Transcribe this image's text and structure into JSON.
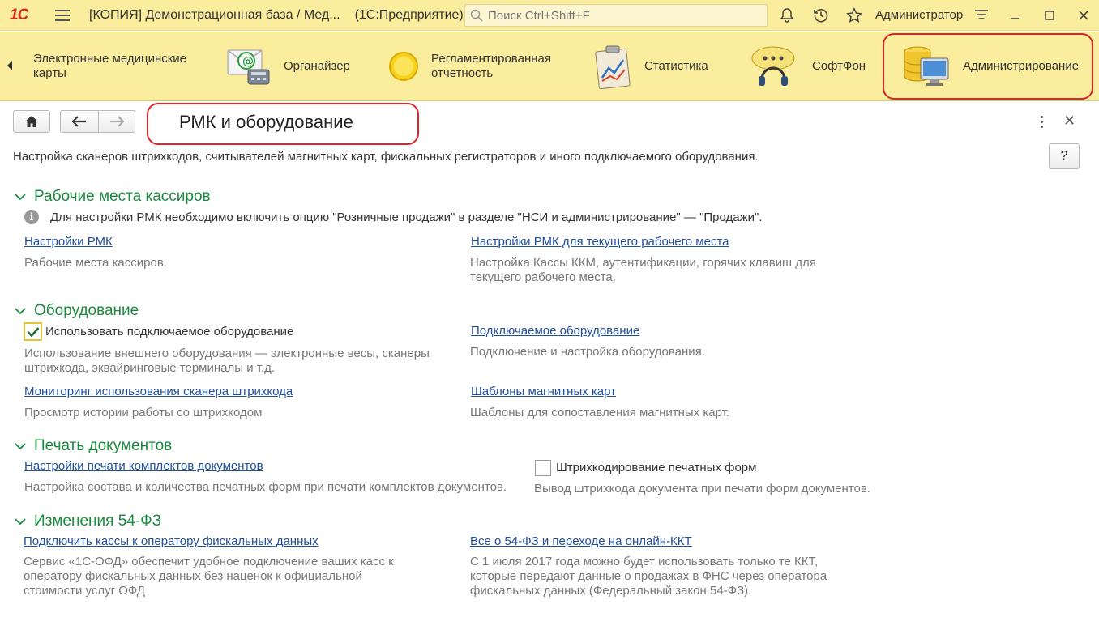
{
  "titlebar": {
    "logo": "1С",
    "title": "[КОПИЯ] Демонстрационная база / Мед...",
    "platform": "(1С:Предприятие)",
    "search_placeholder": "Поиск Ctrl+Shift+F",
    "user": "Администратор"
  },
  "sections": [
    {
      "label": "Электронные медицинские карты",
      "icon": "none"
    },
    {
      "label": "Органайзер",
      "icon": "organizer-icon"
    },
    {
      "label": "Регламентированная отчетность",
      "icon": "reporting-icon"
    },
    {
      "label": "Статистика",
      "icon": "statistics-icon"
    },
    {
      "label": "СофтФон",
      "icon": "softphone-icon"
    },
    {
      "label": "Администрирование",
      "icon": "administration-icon",
      "active": true
    }
  ],
  "form": {
    "title": "РМК и оборудование",
    "description": "Настройка сканеров штрихкодов, считывателей магнитных карт, фискальных регистраторов и иного подключаемого оборудования.",
    "help_label": "?"
  },
  "groups": {
    "cashiers": {
      "title": "Рабочие места кассиров",
      "info": "Для настройки РМК необходимо включить опцию \"Розничные продажи\" в разделе \"НСИ и администрирование\" — \"Продажи\".",
      "link1": "Настройки РМК",
      "note1": "Рабочие места кассиров.",
      "link2": "Настройки РМК для текущего рабочего места",
      "note2_line1": "Настройка Кассы ККМ, аутентификации, горячих клавиш для",
      "note2_line2": "текущего рабочего места."
    },
    "equipment": {
      "title": "Оборудование",
      "checkbox_label": "Использовать подключаемое оборудование",
      "checkbox_checked": true,
      "note1_line1": "Использование внешнего оборудования — электронные весы, сканеры",
      "note1_line2": "штрихкода, эквайринговые терминалы и т.д.",
      "link2": "Подключаемое оборудование",
      "note2": "Подключение и настройка оборудования.",
      "link3": "Мониторинг использования сканера штрихкода",
      "note3": "Просмотр истории работы со штрихкодом",
      "link4": "Шаблоны магнитных карт",
      "note4": "Шаблоны для сопоставления магнитных карт."
    },
    "printing": {
      "title": "Печать документов",
      "link1": "Настройки печати комплектов документов",
      "note1": "Настройка состава и количества печатных форм при печати комплектов документов.",
      "checkbox_label": "Штрихкодирование печатных форм",
      "checkbox_checked": false,
      "note2": "Вывод штрихкода документа при печати форм документов."
    },
    "fz54": {
      "title": "Изменения 54-ФЗ",
      "link1": "Подключить кассы к оператору фискальных данных",
      "note1_line1": "Сервис  «1С-ОФД» обеспечит удобное подключение ваших касс к",
      "note1_line2": "оператору фискальных данных без наценок к официальной",
      "note1_line3": "стоимости услуг ОФД",
      "link2": "Все о 54-ФЗ и переходе на онлайн-ККТ",
      "note2_line1": "С 1 июля 2017 года можно будет использовать только те ККТ,",
      "note2_line2": "которые передают данные о продажах в ФНС через оператора",
      "note2_line3": "фискальных данных (Федеральный закон 54-ФЗ)."
    }
  },
  "colors": {
    "panel_bg": "#fbed9e",
    "group_title": "#1a8a3e",
    "link": "#1f4e9e",
    "highlight": "#e0242a"
  }
}
